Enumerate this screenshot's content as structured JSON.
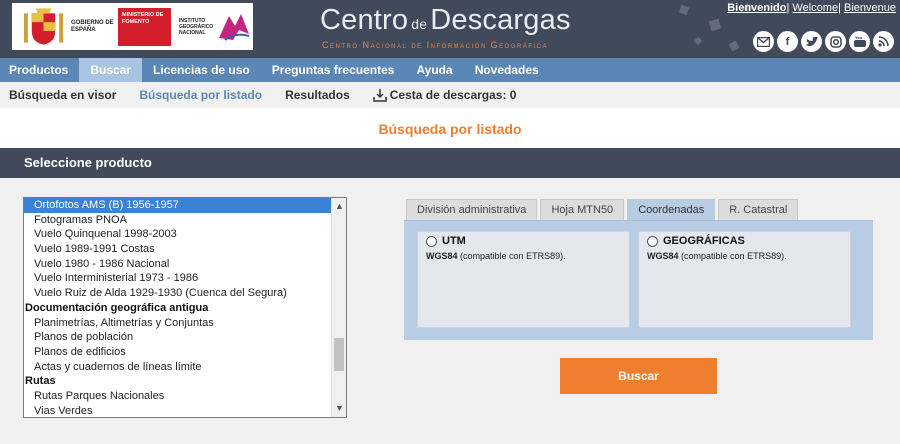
{
  "header": {
    "title_main_1": "Centro",
    "title_de": "de",
    "title_main_2": "Descargas",
    "subtitle": "Centro Nacional de Información Geográfica",
    "logo_gob": "Gobierno de España",
    "logo_ministerio": "Ministerio de Fomento",
    "logo_ign": "Instituto Geográfico Nacional",
    "lang_links": [
      "Bienvenido",
      "Welcome",
      "Bienvenue"
    ],
    "social_icons": [
      "mail-icon",
      "facebook-icon",
      "twitter-icon",
      "instagram-icon",
      "youtube-icon",
      "rss-icon"
    ]
  },
  "mainnav": {
    "items": [
      "Productos",
      "Buscar",
      "Licencias de uso",
      "Preguntas frecuentes",
      "Ayuda",
      "Novedades"
    ],
    "active": "Buscar"
  },
  "subnav": {
    "items": [
      "Búsqueda en visor",
      "Búsqueda por listado",
      "Resultados"
    ],
    "cart_label": "Cesta de descargas: 0",
    "active": "Búsqueda por listado"
  },
  "page_title": "Búsqueda por listado",
  "section_title": "Seleccione producto",
  "product_list": {
    "options": [
      {
        "label": "Ortofotos AMS (B) 1956-1957",
        "type": "option",
        "selected": true
      },
      {
        "label": "Fotogramas PNOA",
        "type": "option"
      },
      {
        "label": "Vuelo Quinquenal 1998-2003",
        "type": "option"
      },
      {
        "label": "Vuelo 1989-1991 Costas",
        "type": "option"
      },
      {
        "label": "Vuelo 1980 - 1986 Nacional",
        "type": "option"
      },
      {
        "label": "Vuelo Interministerial 1973 - 1986",
        "type": "option"
      },
      {
        "label": "Vuelo Ruiz de Alda 1929-1930 (Cuenca del Segura)",
        "type": "option"
      },
      {
        "label": "Documentación geográfica antigua",
        "type": "group"
      },
      {
        "label": "Planimetrías, Altimetrías y Conjuntas",
        "type": "option"
      },
      {
        "label": "Planos de población",
        "type": "option"
      },
      {
        "label": "Planos de edificios",
        "type": "option"
      },
      {
        "label": "Actas y cuadernos de líneas límite",
        "type": "option"
      },
      {
        "label": "Rutas",
        "type": "group"
      },
      {
        "label": "Rutas Parques Nacionales",
        "type": "option"
      },
      {
        "label": "Vias Verdes",
        "type": "option"
      }
    ]
  },
  "tabs": {
    "items": [
      "División administrativa",
      "Hoja MTN50",
      "Coordenadas",
      "R. Catastral"
    ],
    "active": "Coordenadas"
  },
  "coordinates": {
    "utm": {
      "label": "UTM",
      "datum": "WGS84",
      "note": "(compatible con ETRS89)."
    },
    "geo": {
      "label": "GEOGRÁFICAS",
      "datum": "WGS84",
      "note": "(compatible con ETRS89)."
    }
  },
  "search_button": "Buscar",
  "colors": {
    "header_bg": "#414a5a",
    "nav_bg": "#5b87b7",
    "accent_orange": "#ef7e2f",
    "tab_active": "#b8cce4"
  }
}
